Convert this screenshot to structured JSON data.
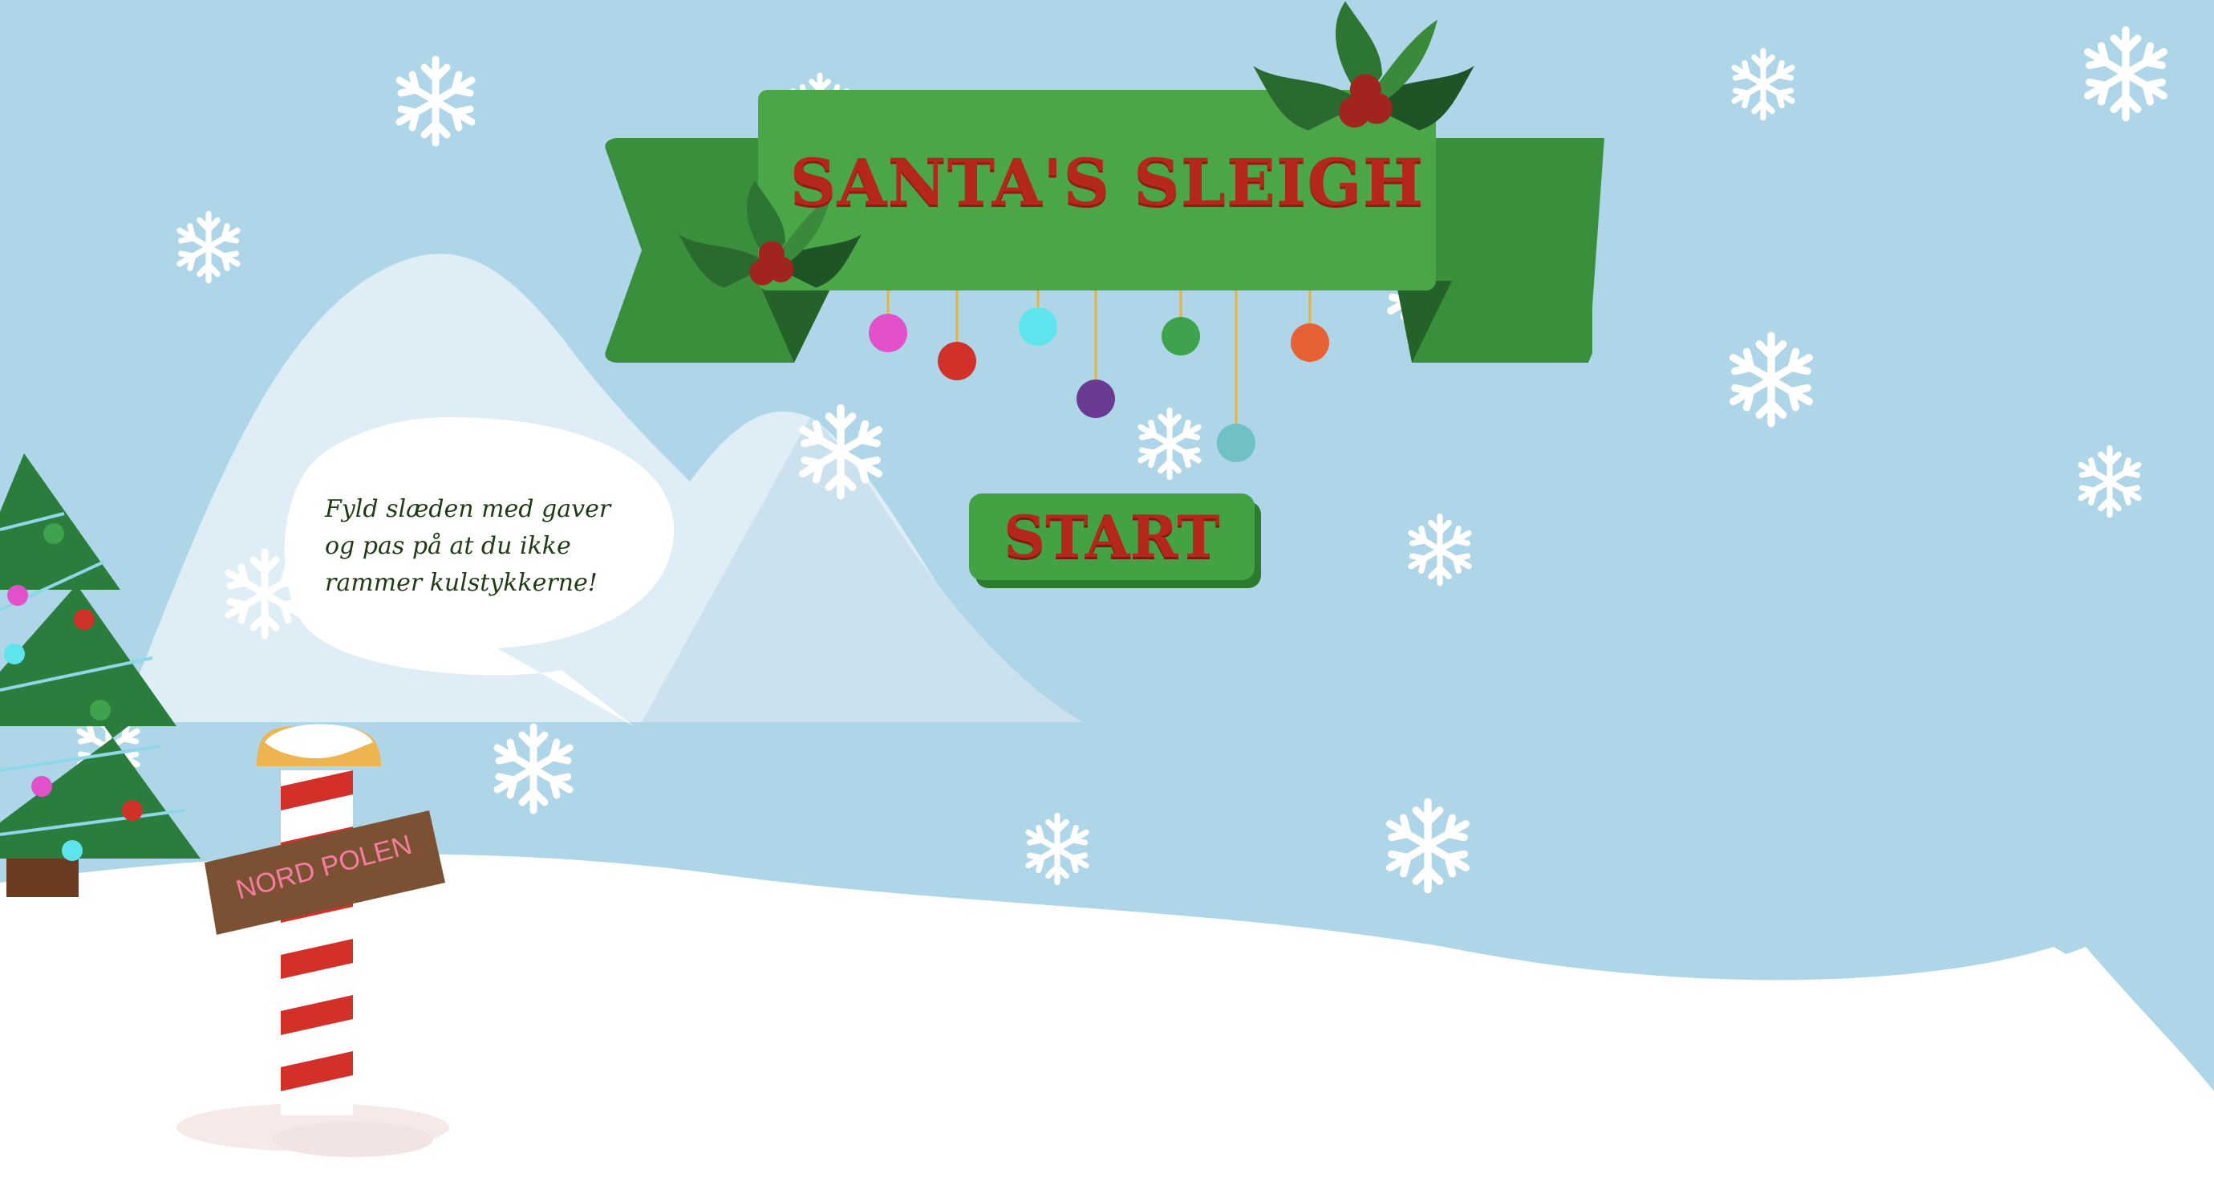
{
  "game": {
    "title": "SANTA'S SLEIGH",
    "start_label": "START",
    "speech": "Fyld slæden med gaver og pas på at du ikke rammer kulstykkerne!",
    "sign_label": "NORD POLEN"
  },
  "colors": {
    "sky": "#aed6e8",
    "snow": "#ffffff",
    "ribbon_green": "#43a344",
    "ribbon_dark": "#2f7d32",
    "title_red": "#b5261d",
    "santa_red": "#d3302a",
    "star_yellow": "#eeb44f",
    "house_brown": "#3a1f14",
    "house_wall": "#b1a090",
    "sleigh_brown": "#7f471f"
  },
  "icons": [
    "snowflake-icon",
    "star-character-icon",
    "bow-icon",
    "ornament-icon",
    "holly-icon",
    "gift-icon"
  ]
}
